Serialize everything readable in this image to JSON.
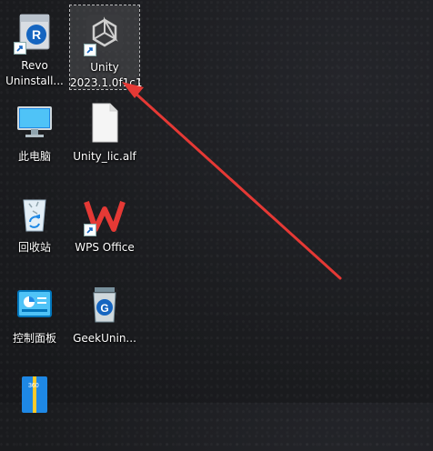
{
  "desktop": {
    "icons": [
      {
        "label": "Revo\nUninstall...",
        "icon": "revo-uninstaller-icon"
      },
      {
        "label": "Unity\n2023.1.0f1c1",
        "icon": "unity-icon",
        "selected": true
      },
      {
        "label": "此电脑",
        "icon": "this-pc-icon"
      },
      {
        "label": "Unity_lic.alf",
        "icon": "file-icon"
      },
      {
        "label": "回收站",
        "icon": "recycle-bin-icon"
      },
      {
        "label": "WPS Office",
        "icon": "wps-office-icon"
      },
      {
        "label": "控制面板",
        "icon": "control-panel-icon"
      },
      {
        "label": "GeekUnin...",
        "icon": "geek-uninstaller-icon"
      },
      {
        "label": "",
        "icon": "360zip-icon"
      }
    ],
    "annotation_color": "#e53935"
  }
}
